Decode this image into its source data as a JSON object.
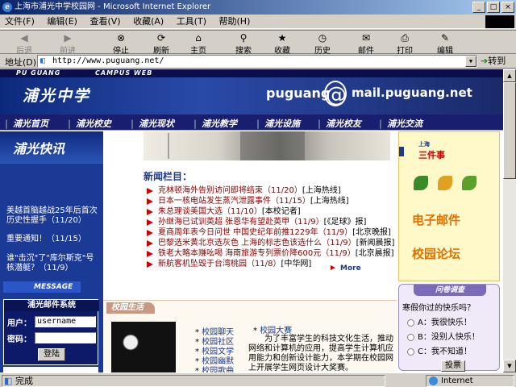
{
  "window": {
    "title": "上海市浦光中学校园网 - Microsoft Internet Explorer",
    "btn_min": "_",
    "btn_max": "□",
    "btn_close": "×"
  },
  "menu": [
    "文件(F)",
    "编辑(E)",
    "查看(V)",
    "收藏(A)",
    "工具(T)",
    "帮助(H)"
  ],
  "toolbar": {
    "back": "后退",
    "forward": "前进",
    "stop": "停止",
    "refresh": "刷新",
    "home": "主页",
    "search": "搜索",
    "favorites": "收藏",
    "history": "历史",
    "mail": "邮件",
    "print": "打印",
    "edit": "编辑"
  },
  "address": {
    "label": "地址(D)",
    "url": "http://www.puguang.net/",
    "go": "转到"
  },
  "status": {
    "text": "完成",
    "zone": "Internet"
  },
  "page": {
    "strip_left": "PU GUANG",
    "strip_right": "CAMPUS WEB",
    "logo": "浦光中学",
    "mail_user": "puguang",
    "mail_at": "@",
    "mail_domain": "mail.puguang.net",
    "nav": [
      "浦光首页",
      "浦光校史",
      "浦光现状",
      "浦光教学",
      "浦光设施",
      "浦光校友",
      "浦光交流"
    ],
    "kuaixun": "浦光快讯",
    "left_news": [
      "美越首脑越战25年后首次历史性握手（11/20）",
      "重要通知！（11/15）",
      "谁\"击沉\"了\"库尔斯克\"号核潜艇？（11/9）"
    ],
    "message": "MESSAGE",
    "mail_title": "浦光邮件系统",
    "user_label": "用户：",
    "user_value": "username",
    "pwd_label": "密码：",
    "login": "登陆",
    "news_title": "新闻栏目：",
    "news": [
      {
        "text": "克林顿海外告别访问即将结束（11/20）",
        "src": "[上海热线]"
      },
      {
        "text": "日本一核电站发生蒸汽泄露事件（11/15）",
        "src": "[上海热线]"
      },
      {
        "text": "朱总理谈美国大选（11/10）",
        "src": "[本校记者]"
      },
      {
        "text": "孙继海已试训英超 张恩华有望赴英甲（11/9）",
        "src": "[《足球》报]"
      },
      {
        "text": "夏商周年表今日问世 中国史纪年前推1229年（11/9）",
        "src": "[北京晚报]"
      },
      {
        "text": "巴黎选米黄北京选灰色 上海的标志色该选什么（11/9）",
        "src": "[新闻晨报]"
      },
      {
        "text": "铁老大略本赚吆喝 海南旅游专列票价降600元（11/9）",
        "src": "[北京晨报]"
      },
      {
        "text": "新航客机坠毁于台湾桃园（11/8）",
        "src": "[中华网]"
      }
    ],
    "more": "More",
    "sanjian_small": "上海",
    "sanjian": "三件事",
    "right_items": [
      "电子邮件",
      "校园论坛"
    ],
    "poll_header": "问卷调查",
    "poll_q": "寒假你过的快乐吗？",
    "poll_opts": [
      "A：我很快乐！",
      "B：没别人快乐！",
      "C：我不知道！"
    ],
    "vote": "投票",
    "campus_title": "校园生活",
    "campus_links": [
      "校园聊天",
      "校园社区",
      "校园文学",
      "校园幽默",
      "校园歌曲"
    ],
    "contest_title": "校园大赛",
    "contest_desc": "为了丰富学生的科技文化生活，推动网络和计算机的应用，提高学生计算机应用能力和创新设计能力，本学期在校园网上开展学生网页设计大奖赛。"
  }
}
